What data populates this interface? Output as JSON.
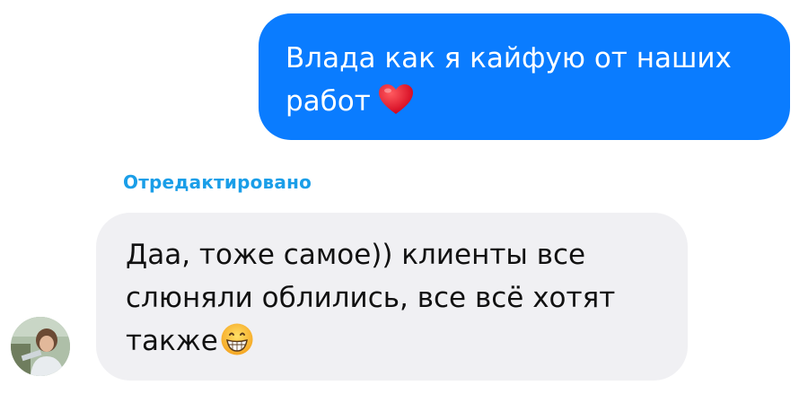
{
  "conversation": {
    "outgoing": {
      "line1": "Влада как я кайфую от наших",
      "line2": "работ",
      "emoji": "heart-icon",
      "color": "#0a7cff"
    },
    "edited_label": "Отредактировано",
    "incoming": {
      "line1": "Даа, тоже самое)) клиенты все",
      "line2": "слюняли облились, все всё хотят",
      "line3": "также",
      "emoji": "grinning-face-icon",
      "color": "#f0f0f3"
    },
    "avatar": "contact-avatar"
  }
}
